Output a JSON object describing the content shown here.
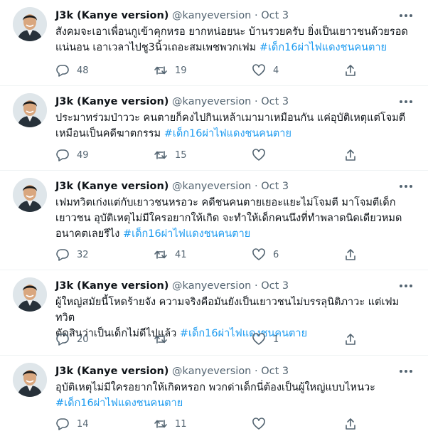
{
  "tweets": [
    {
      "author_name": "J3k (Kanye version)",
      "handle": "@kanyeversion",
      "separator": "·",
      "time": "Oct 3",
      "text_lines": [
        "สังคมจะเอาเพื่อนกูเข้าคุกหรอ ยากหน่อยนะ บ้านรวยครับ ยิ่งเป็นเยาวชนด้วยรอด",
        "แน่นอน เอาเวลาไปชู3นิ้วเถอะสมเพชพวกเฟม"
      ],
      "hashtag": "#เด็ก16ผ่าไฟแดงชนคนตาย",
      "replies": "48",
      "retweets": "19",
      "likes": "4"
    },
    {
      "author_name": "J3k (Kanye version)",
      "handle": "@kanyeversion",
      "separator": "·",
      "time": "Oct 3",
      "text_lines": [
        "ประมาทร่วมป่าววะ คนตายก็คงไปกินเหล้าเมามาเหมือนกัน แค่อุบัติเหตุแต่โจมตี",
        "เหมือนเป็นคดีฆาตกรรม"
      ],
      "hashtag": "#เด็ก16ผ่าไฟแดงชนคนตาย",
      "replies": "49",
      "retweets": "15",
      "likes": ""
    },
    {
      "author_name": "J3k (Kanye version)",
      "handle": "@kanyeversion",
      "separator": "·",
      "time": "Oct 3",
      "text_lines": [
        "เฟมทวิตเก่งแต่กับเยาวชนหรอวะ คดีชนคนตายเยอะแยะไม่โจมตี มาโจมตีเด็ก",
        "เยาวชน อุบัติเหตุไม่มีใครอยากให้เกิด จะทำให้เด็กคนนึงที่ทำพลาดนิดเดียวหมด",
        "อนาคตเลยรึไง"
      ],
      "hashtag": "#เด็ก16ผ่าไฟแดงชนคนตาย",
      "replies": "32",
      "retweets": "41",
      "likes": "6"
    },
    {
      "author_name": "J3k (Kanye version)",
      "handle": "@kanyeversion",
      "separator": "·",
      "time": "Oct 3",
      "text_lines": [
        "ผู้ใหญ่สมัยนี้โหดร้ายจัง ความจริงคือมันยังเป็นเยาวชนไม่บรรลุนิติภาวะ แต่เฟมทวิต",
        "ตัดสินว่าเป็นเด็กไม่ดีไปแล้ว"
      ],
      "hashtag": "#เด็ก16ผ่าไฟแดงชนคนตาย",
      "replies": "20",
      "retweets": "",
      "likes": "1"
    },
    {
      "author_name": "J3k (Kanye version)",
      "handle": "@kanyeversion",
      "separator": "·",
      "time": "Oct 3",
      "text_lines": [
        "อุบัติเหตุไม่มีใครอยากให้เกิดหรอก พวกด่าเด็กนี่ต้องเป็นผู้ใหญ่แบบไหนวะ"
      ],
      "hashtag": "#เด็ก16ผ่าไฟแดงชนคนตาย",
      "replies": "14",
      "retweets": "11",
      "likes": ""
    }
  ],
  "icons": {
    "reply": "reply-icon",
    "retweet": "retweet-icon",
    "like": "heart-icon",
    "share": "share-icon",
    "more": "more-icon"
  },
  "colors": {
    "text": "#0f1419",
    "secondary": "#536471",
    "hashtag": "#1d9bf0",
    "divider": "#eff3f4"
  }
}
